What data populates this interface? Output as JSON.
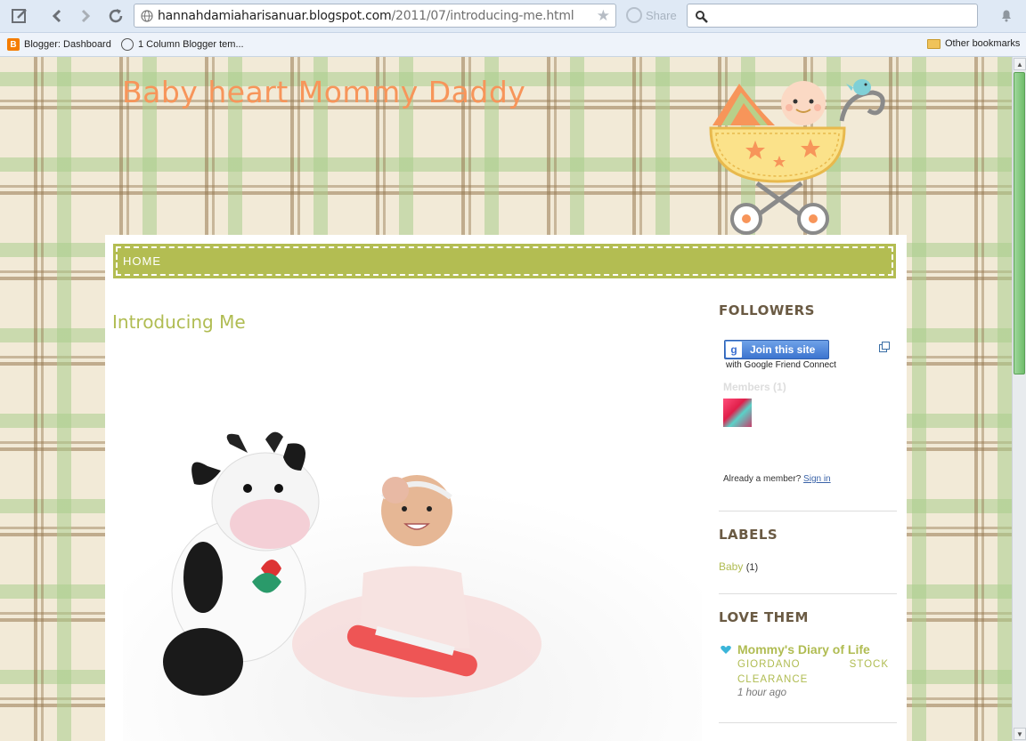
{
  "browser": {
    "url_host": "hannahdamiaharisanuar.blogspot.com",
    "url_path": "/2011/07/introducing-me.html",
    "share_label": "Share",
    "bookmarks": [
      {
        "label": "Blogger: Dashboard",
        "icon": "blogger-icon"
      },
      {
        "label": "1 Column Blogger tem...",
        "icon": "globe-icon"
      }
    ],
    "other_bookmarks": "Other bookmarks"
  },
  "blog": {
    "title": "Baby heart Mommy Daddy",
    "nav": {
      "home": "HOME"
    },
    "post": {
      "title": "Introducing Me"
    }
  },
  "sidebar": {
    "followers": {
      "title": "FOLLOWERS",
      "join_button": "Join this site",
      "subtext": "with Google Friend Connect",
      "members": "Members (1)",
      "already": "Already a member?",
      "sign_in": "Sign in"
    },
    "labels": {
      "title": "LABELS",
      "items": [
        {
          "name": "Baby",
          "count": "(1)"
        }
      ]
    },
    "love": {
      "title": "LOVE THEM",
      "blog_name": "Mommy's Diary of Life",
      "post_title": "GIORDANO STOCK CLEARANCE",
      "time": "1 hour ago"
    }
  },
  "colors": {
    "title_orange": "#f7955a",
    "accent_green": "#b0bc52",
    "heading_brown": "#6a5a43"
  }
}
